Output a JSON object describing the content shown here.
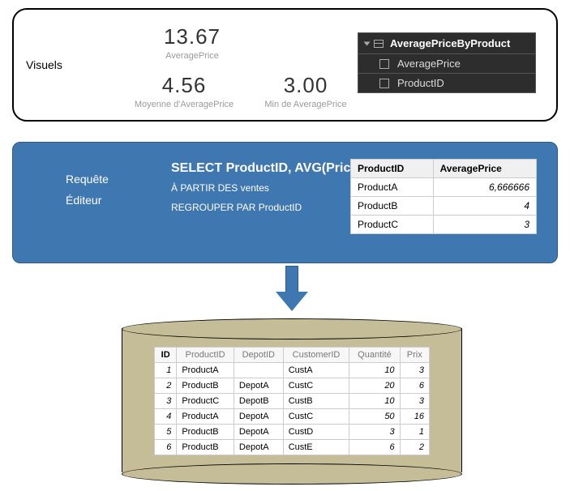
{
  "visuals": {
    "label": "Visuels",
    "kpi1": {
      "value": "13.67",
      "sub": "AveragePrice"
    },
    "kpi2": {
      "value": "4.56",
      "sub": "Moyenne d'AveragePrice"
    },
    "kpi3": {
      "value": "3.00",
      "sub": "Min de AveragePrice"
    }
  },
  "fields": {
    "table": "AveragePriceByProduct",
    "cols": [
      "AveragePrice",
      "ProductID"
    ]
  },
  "query": {
    "label1": "Requête",
    "label2": "Éditeur",
    "line1": "SELECT ProductID, AVG(Price) As AveragePrice",
    "line2": "À PARTIR DES ventes",
    "line3": "REGROUPER PAR ProductID"
  },
  "result": {
    "headers": [
      "ProductID",
      "AveragePrice"
    ],
    "rows": [
      [
        "ProductA",
        "6,666666"
      ],
      [
        "ProductB",
        "4"
      ],
      [
        "ProductC",
        "3"
      ]
    ]
  },
  "sales": {
    "headers": [
      "ID",
      "ProductID",
      "DepotID",
      "CustomerID",
      "Quantité",
      "Prix"
    ],
    "rows": [
      [
        "1",
        "ProductA",
        "",
        "CustA",
        "10",
        "3"
      ],
      [
        "2",
        "ProductB",
        "DepotA",
        "CustC",
        "20",
        "6"
      ],
      [
        "3",
        "ProductC",
        "DepotB",
        "CustB",
        "10",
        "3"
      ],
      [
        "4",
        "ProductA",
        "DepotA",
        "CustC",
        "50",
        "16"
      ],
      [
        "5",
        "ProductB",
        "DepotA",
        "CustD",
        "3",
        "1"
      ],
      [
        "6",
        "ProductB",
        "DepotA",
        "CustE",
        "6",
        "2"
      ]
    ]
  }
}
